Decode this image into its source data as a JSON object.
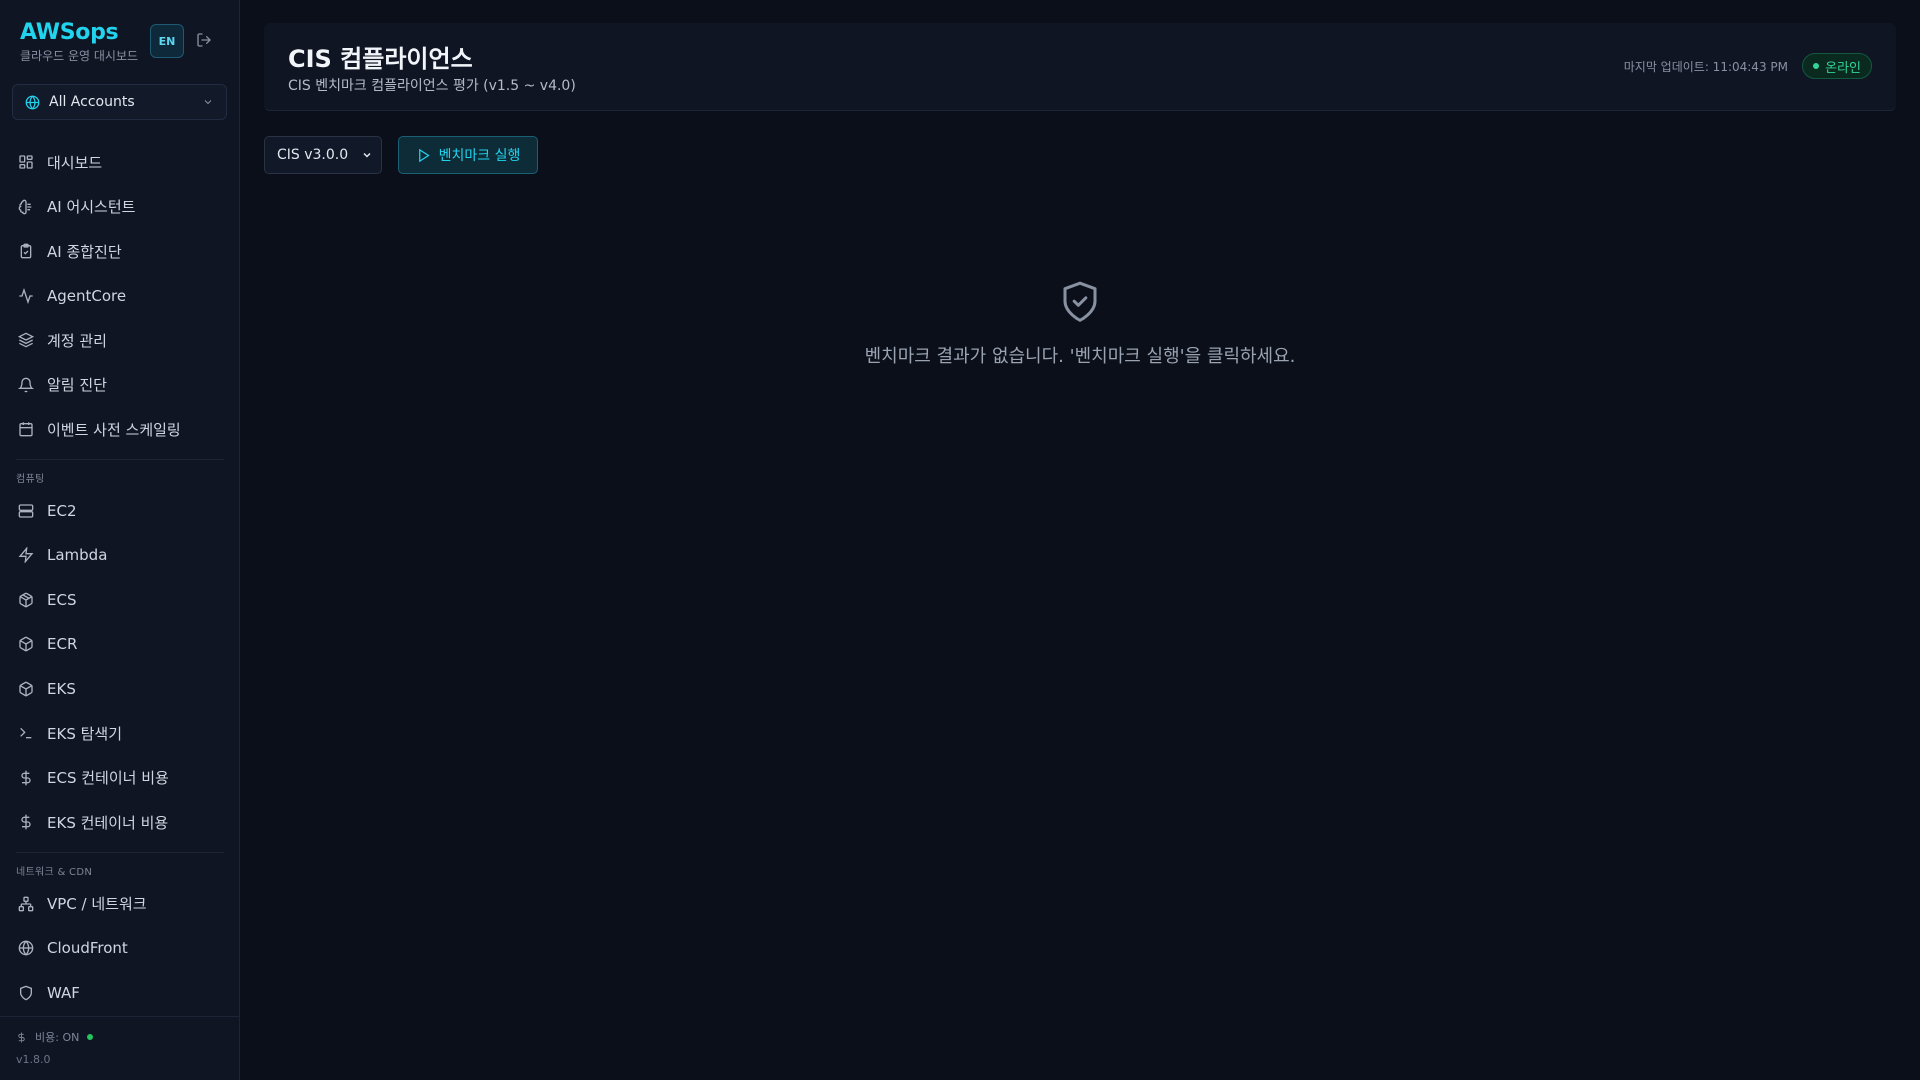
{
  "sidebar": {
    "brand_title": "AWSops",
    "brand_subtitle": "클라우드 운영 대시보드",
    "lang_button": "EN",
    "account_selector": "All Accounts",
    "items_top": [
      {
        "label": "대시보드",
        "icon": "grid-icon"
      },
      {
        "label": "AI 어시스턴트",
        "icon": "brain-icon"
      },
      {
        "label": "AI 종합진단",
        "icon": "clipboard-check-icon"
      },
      {
        "label": "AgentCore",
        "icon": "activity-icon"
      },
      {
        "label": "계정 관리",
        "icon": "layers-icon"
      },
      {
        "label": "알림 진단",
        "icon": "bell-icon"
      },
      {
        "label": "이벤트 사전 스케일링",
        "icon": "calendar-icon"
      }
    ],
    "section_compute": "컴퓨팅",
    "items_compute": [
      {
        "label": "EC2",
        "icon": "server-icon"
      },
      {
        "label": "Lambda",
        "icon": "zap-icon"
      },
      {
        "label": "ECS",
        "icon": "box-icon"
      },
      {
        "label": "ECR",
        "icon": "package-icon"
      },
      {
        "label": "EKS",
        "icon": "cube-icon"
      },
      {
        "label": "EKS 탐색기",
        "icon": "terminal-icon"
      },
      {
        "label": "ECS 컨테이너 비용",
        "icon": "dollar-icon"
      },
      {
        "label": "EKS 컨테이너 비용",
        "icon": "dollar-icon"
      }
    ],
    "section_network": "네트워크 & CDN",
    "items_network": [
      {
        "label": "VPC / 네트워크",
        "icon": "network-icon"
      },
      {
        "label": "CloudFront",
        "icon": "globe-icon"
      },
      {
        "label": "WAF",
        "icon": "shield-icon"
      }
    ],
    "cost_status": "비용: ON",
    "version": "v1.8.0"
  },
  "header": {
    "title": "CIS 컴플라이언스",
    "subtitle": "CIS 벤치마크 컴플라이언스 평가 (v1.5 ~ v4.0)",
    "last_update": "마지막 업데이트: 11:04:43 PM",
    "status_badge": "온라인"
  },
  "toolbar": {
    "version_selected": "CIS v3.0.0",
    "run_button": "벤치마크 실행"
  },
  "empty_state": {
    "icon": "shield-check-icon",
    "message": "벤치마크 결과가 없습니다. '벤치마크 실행'을 클릭하세요."
  },
  "colors": {
    "accent": "#22d3ee",
    "online": "#34d399",
    "background": "#0b0f19",
    "panel": "#0f1523"
  }
}
